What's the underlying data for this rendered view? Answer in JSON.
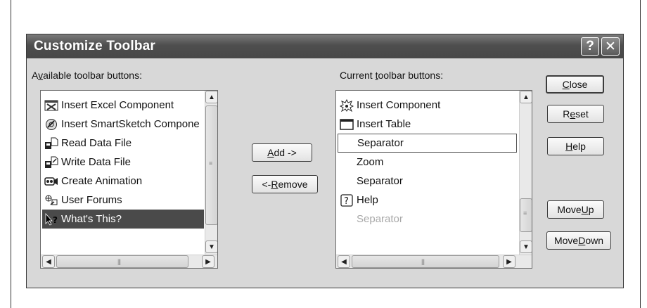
{
  "dialog": {
    "title": "Customize Toolbar",
    "help_glyph": "?",
    "close_glyph": "✕"
  },
  "available": {
    "label_pre": "A",
    "label_key": "v",
    "label_post": "ailable toolbar buttons:",
    "items": [
      {
        "label": "Insert Excel Component",
        "icon": "excel-component-icon"
      },
      {
        "label": "Insert SmartSketch Compone",
        "icon": "smartsketch-icon"
      },
      {
        "label": "Read Data File",
        "icon": "read-data-file-icon"
      },
      {
        "label": "Write Data File",
        "icon": "write-data-file-icon"
      },
      {
        "label": "Create Animation",
        "icon": "create-animation-icon"
      },
      {
        "label": "User Forums",
        "icon": "user-forums-icon"
      },
      {
        "label": "What's This?",
        "icon": "whats-this-icon",
        "selected": true
      }
    ]
  },
  "current": {
    "label_pre": "Current ",
    "label_key": "t",
    "label_post": "oolbar buttons:",
    "items": [
      {
        "label": "Insert Component",
        "icon": "insert-component-icon"
      },
      {
        "label": "Insert Table",
        "icon": "insert-table-icon"
      },
      {
        "label": "Separator",
        "focused": true
      },
      {
        "label": "Zoom"
      },
      {
        "label": "Separator"
      },
      {
        "label": "Help",
        "icon": "help-icon"
      },
      {
        "label": "Separator",
        "disabled": true
      }
    ]
  },
  "buttons": {
    "add": {
      "key": "A",
      "rest": "dd ->"
    },
    "remove": {
      "pre": "<- ",
      "key": "R",
      "rest": "emove"
    },
    "close": {
      "key": "C",
      "rest": "lose"
    },
    "reset": {
      "pre": "R",
      "key": "e",
      "rest": "set"
    },
    "help": {
      "key": "H",
      "rest": "elp"
    },
    "move_up": {
      "pre": "Move ",
      "key": "U",
      "rest": "p"
    },
    "move_down": {
      "pre": "Move ",
      "key": "D",
      "rest": "own"
    }
  },
  "glyphs": {
    "up": "▲",
    "down": "▼",
    "left": "◀",
    "right": "▶",
    "grip_h": "|||",
    "grip_v": "≡"
  },
  "colors": {
    "titlebar": "#4e4e4e",
    "selection": "#4a4a4a",
    "dialog_bg": "#d8d8d8"
  }
}
